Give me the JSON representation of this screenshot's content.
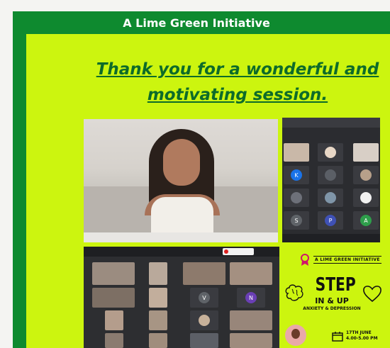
{
  "banner": {
    "title": "A Lime Green Initiative"
  },
  "headline": {
    "line1": "Thank you for a wonderful and",
    "line2": "motivating session."
  },
  "colors": {
    "frame_green": "#0e8a2f",
    "lime": "#ccf50f",
    "headline_green": "#0d6b2a"
  },
  "meeting_grid_right": {
    "avatars": [
      "K",
      "S",
      "P",
      "A"
    ]
  },
  "meeting_grid_bottom": {
    "avatars": [
      "V",
      "N"
    ]
  },
  "poster": {
    "org": "A LIME GREEN INITIATIVE",
    "title": "STEP",
    "subtitle": "IN & UP",
    "topic": "ANXIETY & DEPRESSION",
    "date": "17TH JUNE",
    "time": "4.00-5.00 PM",
    "icons": [
      "ribbon-icon",
      "brain-icon",
      "heart-icon",
      "calendar-icon"
    ]
  }
}
